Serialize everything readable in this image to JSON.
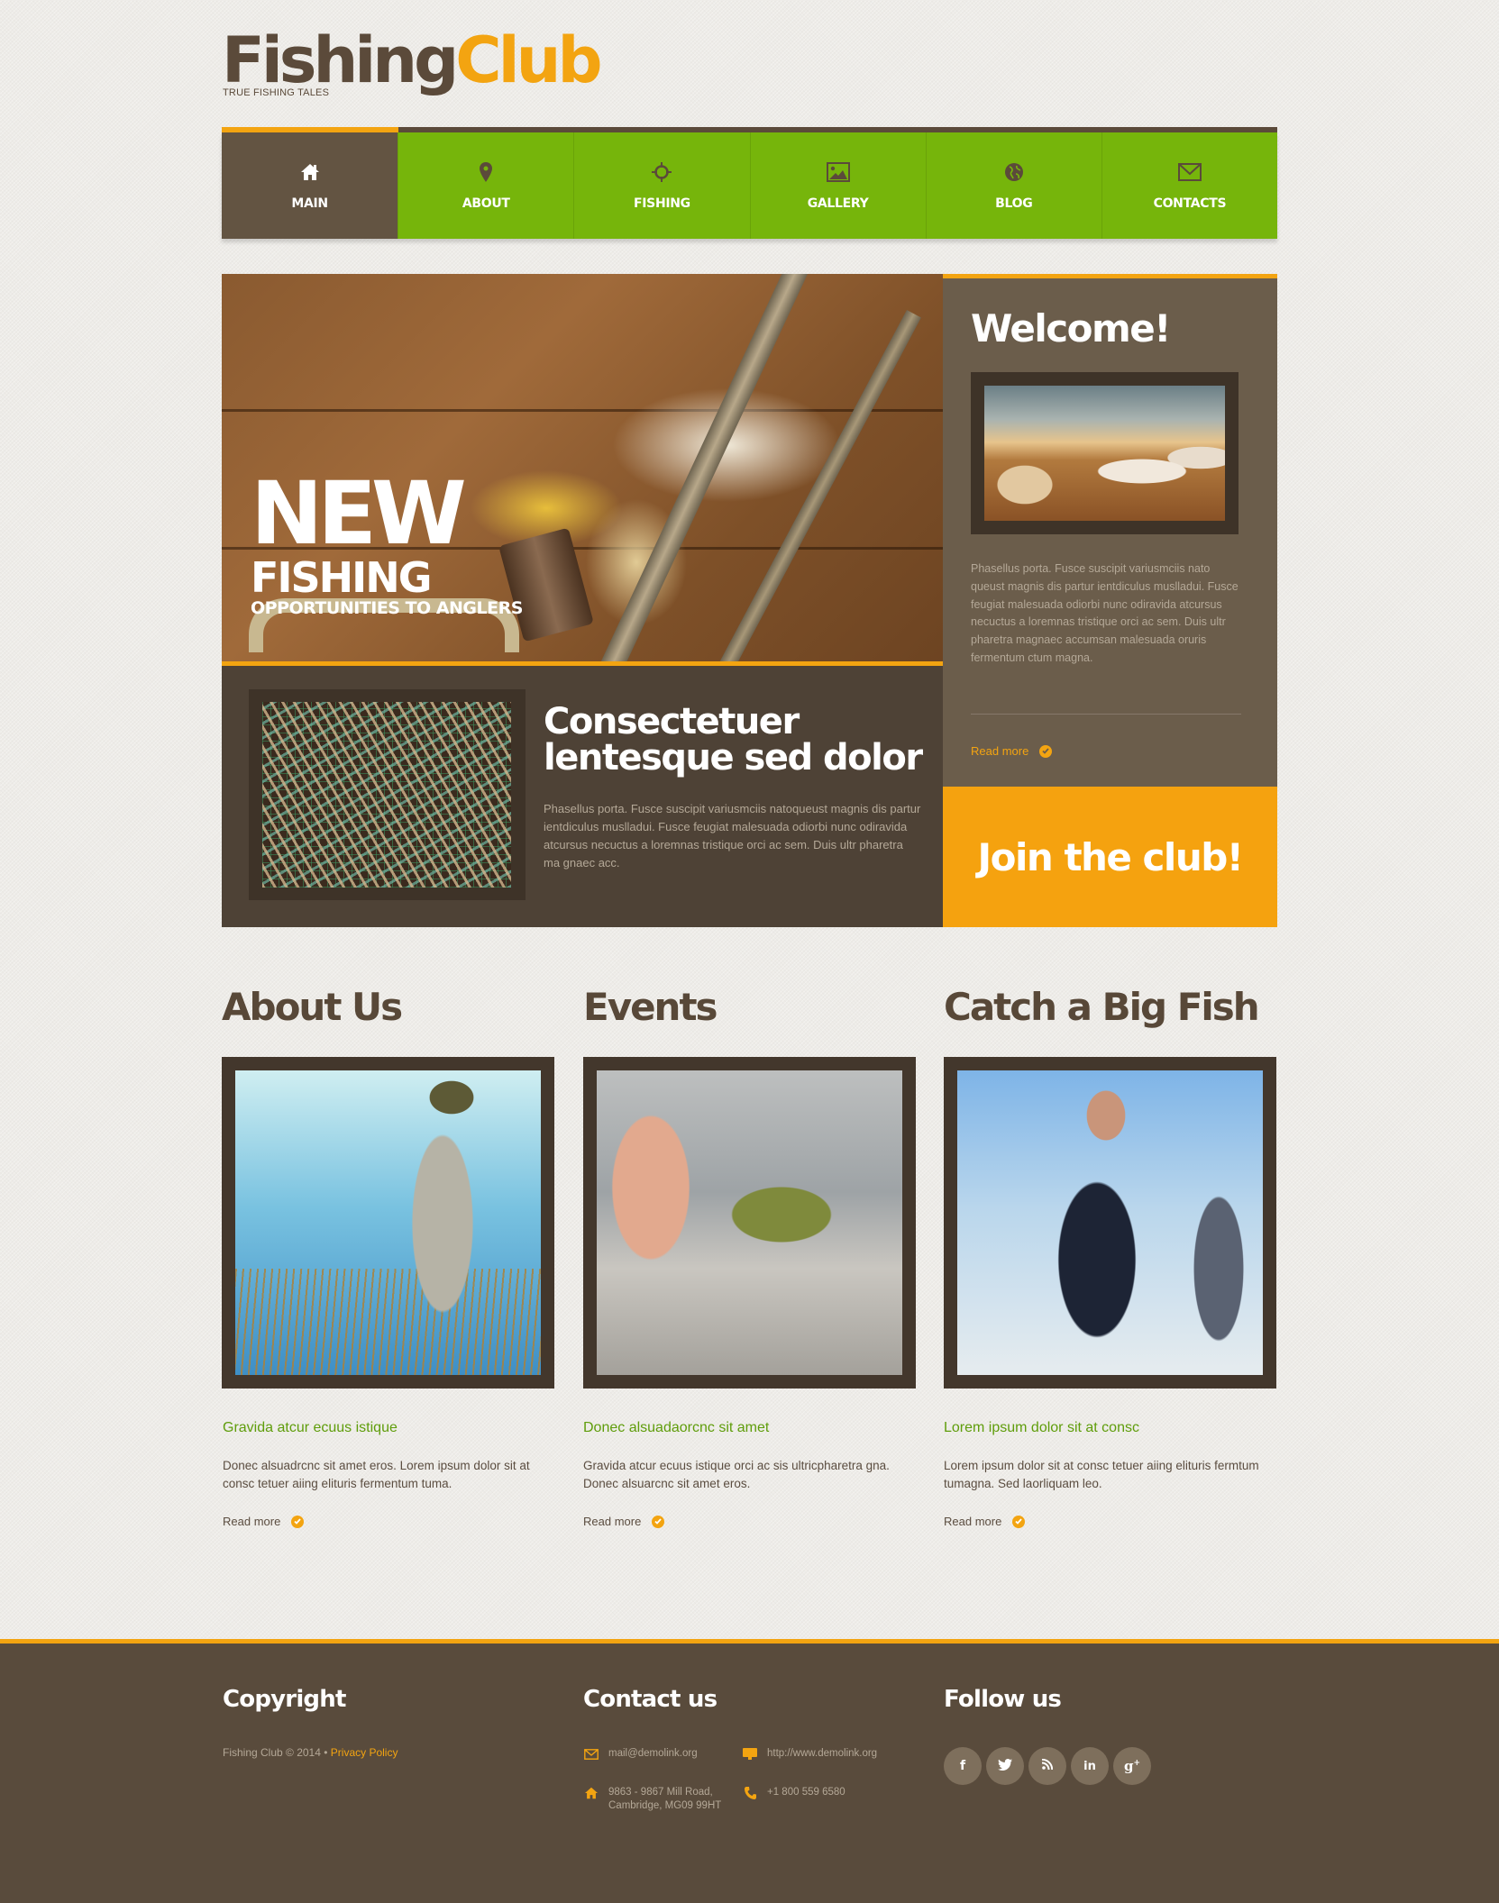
{
  "logo": {
    "part1": "Fishing",
    "part2": "Club",
    "tagline": "TRUE FISHING TALES"
  },
  "nav": {
    "items": [
      {
        "label": "MAIN",
        "icon": "home-icon",
        "active": true
      },
      {
        "label": "ABOUT",
        "icon": "map-marker-icon",
        "active": false
      },
      {
        "label": "FISHING",
        "icon": "crosshairs-icon",
        "active": false
      },
      {
        "label": "GALLERY",
        "icon": "picture-icon",
        "active": false
      },
      {
        "label": "BLOG",
        "icon": "globe-icon",
        "active": false
      },
      {
        "label": "CONTACTS",
        "icon": "envelope-icon",
        "active": false
      }
    ]
  },
  "hero": {
    "line1": "NEW",
    "line2": "FISHING",
    "line3": "OPPORTUNITIES TO ANGLERS",
    "feature_title": "Consectetuer lentesque sed dolor",
    "feature_text": "Phasellus porta. Fusce suscipit variusmciis natoqueust magnis dis partur ientdiculus muslladui. Fusce feugiat malesuada odiorbi nunc odiravida atcursus necuctus a loremnas tristique orci ac sem. Duis ultr pharetra ma gnaec acc."
  },
  "welcome": {
    "title": "Welcome!",
    "text": "Phasellus porta. Fusce suscipit variusmciis nato queust magnis dis partur ientdiculus muslladui. Fusce feugiat malesuada odiorbi nunc odiravida atcursus necuctus a loremnas tristique orci ac sem. Duis ultr pharetra magnaec accumsan malesuada oruris fermentum ctum magna.",
    "read_more": "Read more"
  },
  "join": {
    "label": "Join the club!"
  },
  "columns": [
    {
      "heading": "About Us",
      "subheading": "Gravida atcur ecuus istique",
      "text": "Donec alsuadrcnc sit amet eros. Lorem ipsum dolor sit at consc tetuer aiing elituris fermentum tuma.",
      "read_more": "Read more"
    },
    {
      "heading": "Events",
      "subheading": "Donec alsuadaorcnc sit amet",
      "text": "Gravida atcur ecuus istique orci ac sis ultricpharetra gna. Donec alsuarcnc sit amet eros.",
      "read_more": "Read more"
    },
    {
      "heading": "Catch a Big Fish",
      "subheading": "Lorem ipsum dolor sit at consc",
      "text": "Lorem ipsum dolor sit at consc tetuer aiing elituris fermtum tumagna. Sed laorliquam leo.",
      "read_more": "Read more"
    }
  ],
  "footer": {
    "copyright_heading": "Copyright",
    "copyright_text": "Fishing Club © 2014 • ",
    "privacy_link": "Privacy Policy",
    "contact_heading": "Contact us",
    "email": "mail@demolink.org",
    "website": "http://www.demolink.org",
    "address_line1": "9863 - 9867 Mill Road,",
    "address_line2": "Cambridge, MG09 99HT",
    "phone": "+1 800 559 6580",
    "follow_heading": "Follow us",
    "social": [
      {
        "name": "facebook",
        "glyph": "f"
      },
      {
        "name": "twitter",
        "glyph": "t"
      },
      {
        "name": "rss",
        "glyph": "rss"
      },
      {
        "name": "linkedin",
        "glyph": "in"
      },
      {
        "name": "google-plus",
        "glyph": "g+"
      }
    ]
  },
  "colors": {
    "brown": "#5b4a3a",
    "orange": "#f3a411",
    "green": "#76b50b",
    "dark_brown": "#4e4236"
  }
}
